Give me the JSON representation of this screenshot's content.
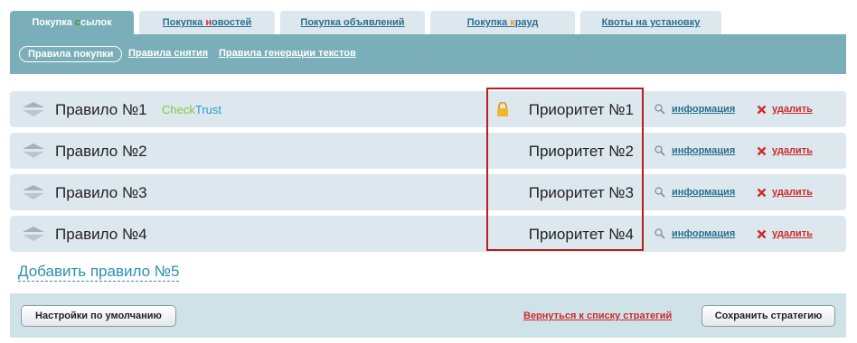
{
  "tabs": [
    {
      "label_parts": [
        "Покупка ",
        "с",
        "сылок"
      ],
      "active": true
    },
    {
      "label_parts": [
        "Покупка ",
        "н",
        "овостей"
      ],
      "active": false
    },
    {
      "label_parts": [
        "Покупка о",
        "б",
        "ъявлений"
      ],
      "active": false
    },
    {
      "label_parts": [
        "Покупка ",
        "к",
        "рауд"
      ],
      "active": false
    },
    {
      "label_parts": [
        "Квоты на установку",
        "",
        ""
      ],
      "active": false
    }
  ],
  "subnav": {
    "active_label": "Правила покупки",
    "link_1": "Правила снятия",
    "link_2": "Правила генерации текстов"
  },
  "rules": [
    {
      "name": "Правило №1",
      "badge_1": "Check",
      "badge_2": "Trust",
      "priority": "Приоритет №1",
      "locked": true
    },
    {
      "name": "Правило №2",
      "priority": "Приоритет №2",
      "locked": false
    },
    {
      "name": "Правило №3",
      "priority": "Приоритет №3",
      "locked": false
    },
    {
      "name": "Правило №4",
      "priority": "Приоритет №4",
      "locked": false
    }
  ],
  "row_actions": {
    "info_label": "информация",
    "delete_label": "удалить"
  },
  "add_rule_label": "Добавить правило №5",
  "footer": {
    "defaults_button": "Настройки по умолчанию",
    "back_link": "Вернуться к списку стратегий",
    "save_button": "Сохранить стратегию"
  },
  "colors": {
    "tab_letter_accents": [
      "#3a9b3a",
      "#cc2b2b",
      "#2a6f8f",
      "#e0a020"
    ]
  }
}
